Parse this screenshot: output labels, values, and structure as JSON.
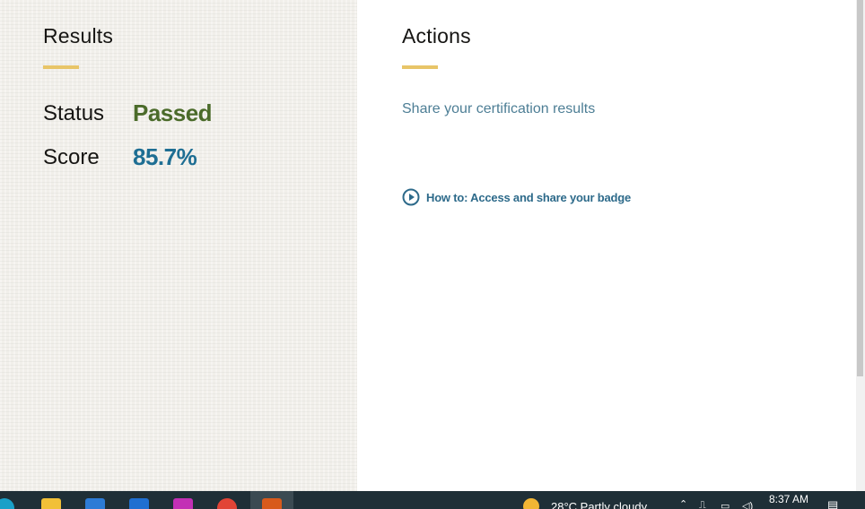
{
  "results": {
    "title": "Results",
    "status_label": "Status",
    "status_value": "Passed",
    "score_label": "Score",
    "score_value": "85.7%"
  },
  "actions": {
    "title": "Actions",
    "share_text": "Share your certification results",
    "howto_link": "How to: Access and share your badge"
  },
  "colors": {
    "accent_underline": "#e8c568",
    "passed": "#4b6b2a",
    "score": "#1e6e93",
    "link": "#2d6a8a"
  },
  "taskbar": {
    "weather": "28°C  Partly cloudy",
    "time": "8:37 AM",
    "icons": [
      "edge-icon",
      "file-explorer-icon",
      "store-icon",
      "mail-icon",
      "instagram-icon",
      "chrome-icon",
      "app-icon"
    ]
  }
}
